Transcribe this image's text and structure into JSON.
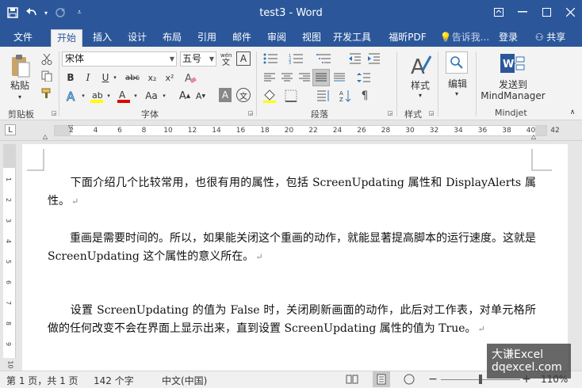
{
  "titlebar": {
    "doc_title": "test3 - Word"
  },
  "tabs": [
    "文件",
    "开始",
    "插入",
    "设计",
    "布局",
    "引用",
    "邮件",
    "审阅",
    "视图",
    "开发工具",
    "福昕PDF"
  ],
  "tell_me": "告诉我...",
  "login": "登录",
  "share": "共享",
  "ribbon": {
    "paste_label": "粘贴",
    "clipboard_group": "剪贴板",
    "font_name": "宋体",
    "font_size": "五号",
    "font_group": "字体",
    "para_group": "段落",
    "style_label": "样式",
    "style_group": "样式",
    "edit_label": "编辑",
    "mindjet_label1": "发送到",
    "mindjet_label2": "MindManager",
    "mindjet_group": "Mindjet",
    "bold": "B",
    "italic": "I",
    "underline": "U",
    "strike": "abc",
    "sub": "x₂",
    "sup": "x²",
    "aa": "Aa",
    "grow": "A",
    "shrink": "A",
    "wen": "文",
    "fontA": "A"
  },
  "ruler": {
    "numbers": [
      "2",
      "4",
      "6",
      "8",
      "10",
      "12",
      "14",
      "16",
      "18",
      "20",
      "22",
      "24",
      "26",
      "28",
      "30",
      "32",
      "34",
      "36",
      "38",
      "40",
      "42"
    ]
  },
  "vruler": {
    "numbers": [
      "1",
      "2",
      "3",
      "4",
      "5",
      "6",
      "7",
      "8",
      "9",
      "10"
    ]
  },
  "document": {
    "paragraphs": [
      "　　下面介绍几个比较常用，也很有用的属性，包括 ScreenUpdating 属性和 DisplayAlerts 属性。",
      "　　重画是需要时间的。所以，如果能关闭这个重画的动作，就能显著提高脚本的运行速度。这就是 ScreenUpdating 这个属性的意义所在。",
      "　　设置 ScreenUpdating 的值为 False 时，关闭刷新画面的动作，此后对工作表，对单元格所做的任何改变不会在界面上显示出来，直到设置 ScreenUpdating 属性的值为 True。"
    ],
    "para_mark": "↵"
  },
  "status": {
    "page": "第 1 页，共 1 页",
    "words": "142 个字",
    "lang": "中文(中国)",
    "zoom": "110%"
  },
  "watermark": {
    "line1": "大谦Excel",
    "line2": "dqexcel.com"
  },
  "colors": {
    "accent": "#2b579a",
    "highlight": "#ffff00",
    "font_color": "#e00000"
  }
}
